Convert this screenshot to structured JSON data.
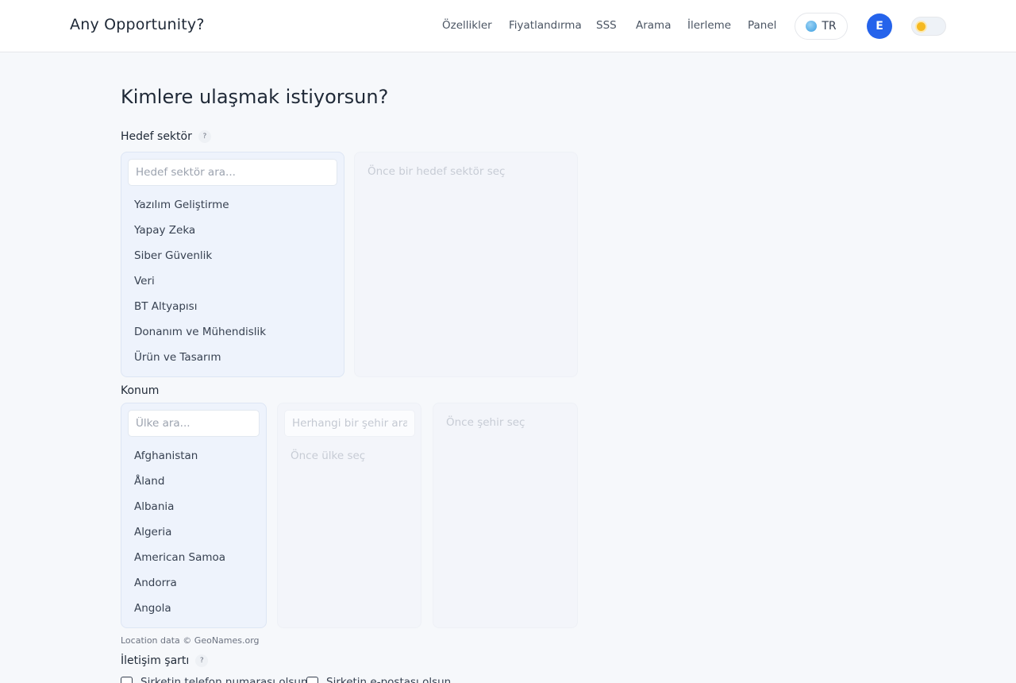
{
  "header": {
    "brand": "Any Opportunity?",
    "nav": [
      "Özellikler",
      "Fiyatlandırma",
      "SSS",
      "Arama",
      "İlerleme",
      "Panel"
    ],
    "lang": "TR",
    "avatar_initial": "E"
  },
  "main": {
    "title": "Kimlere ulaşmak istiyorsun?",
    "sector": {
      "label": "Hedef sektör",
      "help": "?",
      "search_placeholder": "Hedef sektör ara...",
      "items": [
        "Yazılım Geliştirme",
        "Yapay Zeka",
        "Siber Güvenlik",
        "Veri",
        "BT Altyapısı",
        "Donanım ve Mühendislik",
        "Ürün ve Tasarım"
      ],
      "subsector_placeholder": "Önce bir hedef sektör seç"
    },
    "location": {
      "label": "Konum",
      "country_search_placeholder": "Ülke ara...",
      "countries": [
        "Afghanistan",
        "Åland",
        "Albania",
        "Algeria",
        "American Samoa",
        "Andorra",
        "Angola"
      ],
      "city_search_placeholder": "Herhangi bir şehir ara...",
      "city_placeholder": "Önce ülke seç",
      "district_placeholder": "Önce şehir seç",
      "attribution": "Location data © GeoNames.org"
    },
    "contact": {
      "label": "İletişim şartı",
      "help": "?",
      "options": [
        "Şirketin telefon numarası olsun",
        "Şirketin e-postası olsun"
      ]
    }
  }
}
